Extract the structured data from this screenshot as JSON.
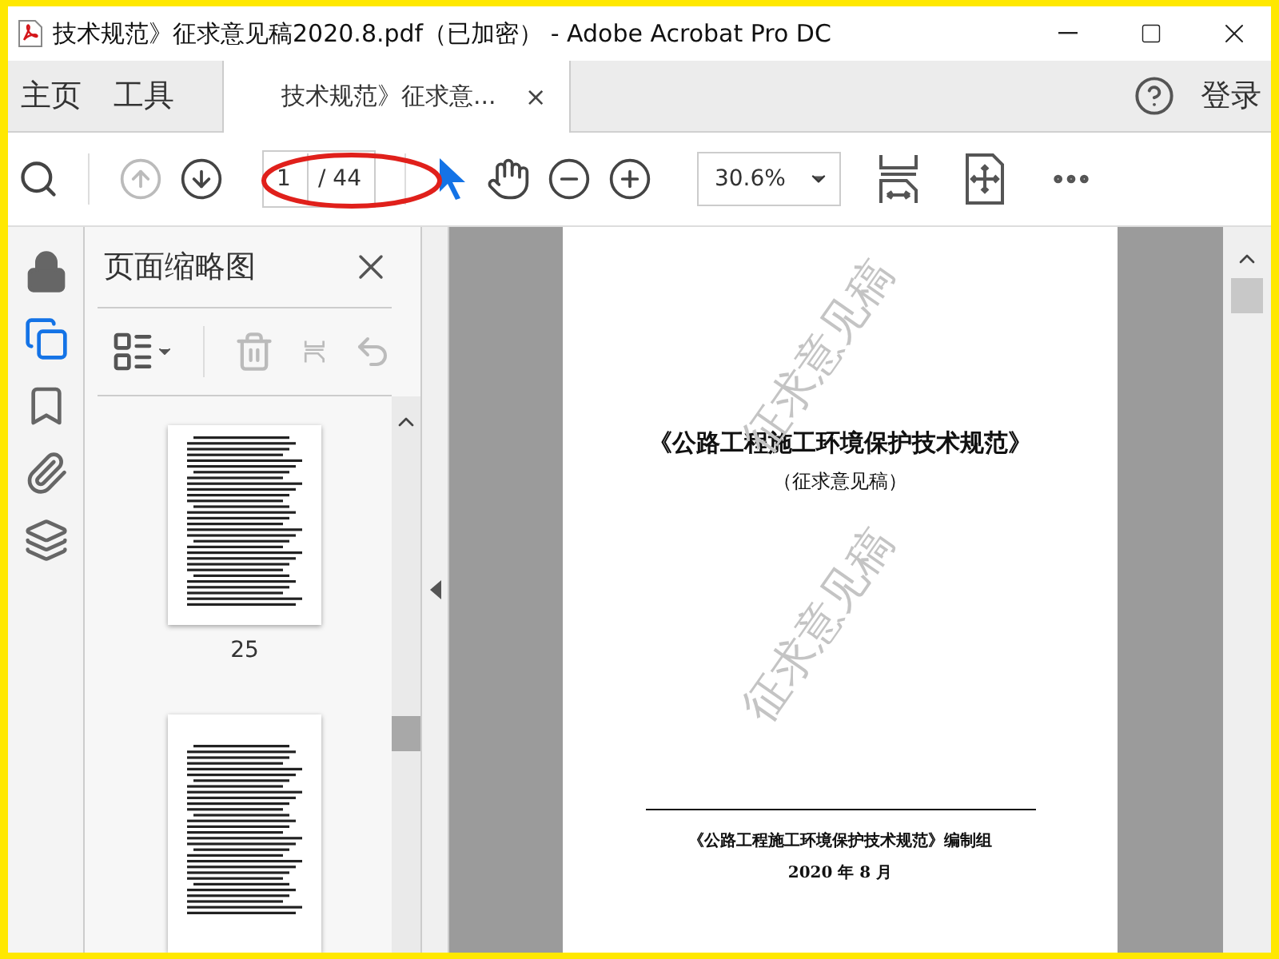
{
  "window": {
    "title": "技术规范》征求意见稿2020.8.pdf（已加密） - Adobe Acrobat Pro DC"
  },
  "nav_tabs": [
    {
      "label": "主页",
      "selected": false
    },
    {
      "label": "工具",
      "selected": false
    },
    {
      "label": "技术规范》征求意...",
      "selected": true,
      "close": "×"
    }
  ],
  "sign_in": "登录",
  "toolbar": {
    "prev_disabled": true,
    "page_value": "1",
    "page_total": "/ 44",
    "zoom": "30.6%"
  },
  "annotation": {
    "kind": "ellipse"
  },
  "side_rail": [
    {
      "kind": "lock",
      "selected": false
    },
    {
      "kind": "pages",
      "selected": true
    },
    {
      "kind": "bookmark",
      "selected": false
    },
    {
      "kind": "attachment",
      "selected": false
    },
    {
      "kind": "layers",
      "selected": false
    }
  ],
  "thumbnail_panel": {
    "title": "页面缩略图",
    "delete_disabled": true,
    "thumbnails": [
      {
        "label": "25",
        "cut_off": false
      },
      {
        "cut_off": true
      }
    ]
  },
  "document": {
    "title": "《公路工程施工环境保护技术规范》",
    "subtitle": "（征求意见稿）",
    "issuer": "《公路工程施工环境保护技术规范》编制组",
    "date": "2020 年 8 月",
    "watermarks": [
      "征求意见稿",
      "征求意见稿"
    ]
  }
}
